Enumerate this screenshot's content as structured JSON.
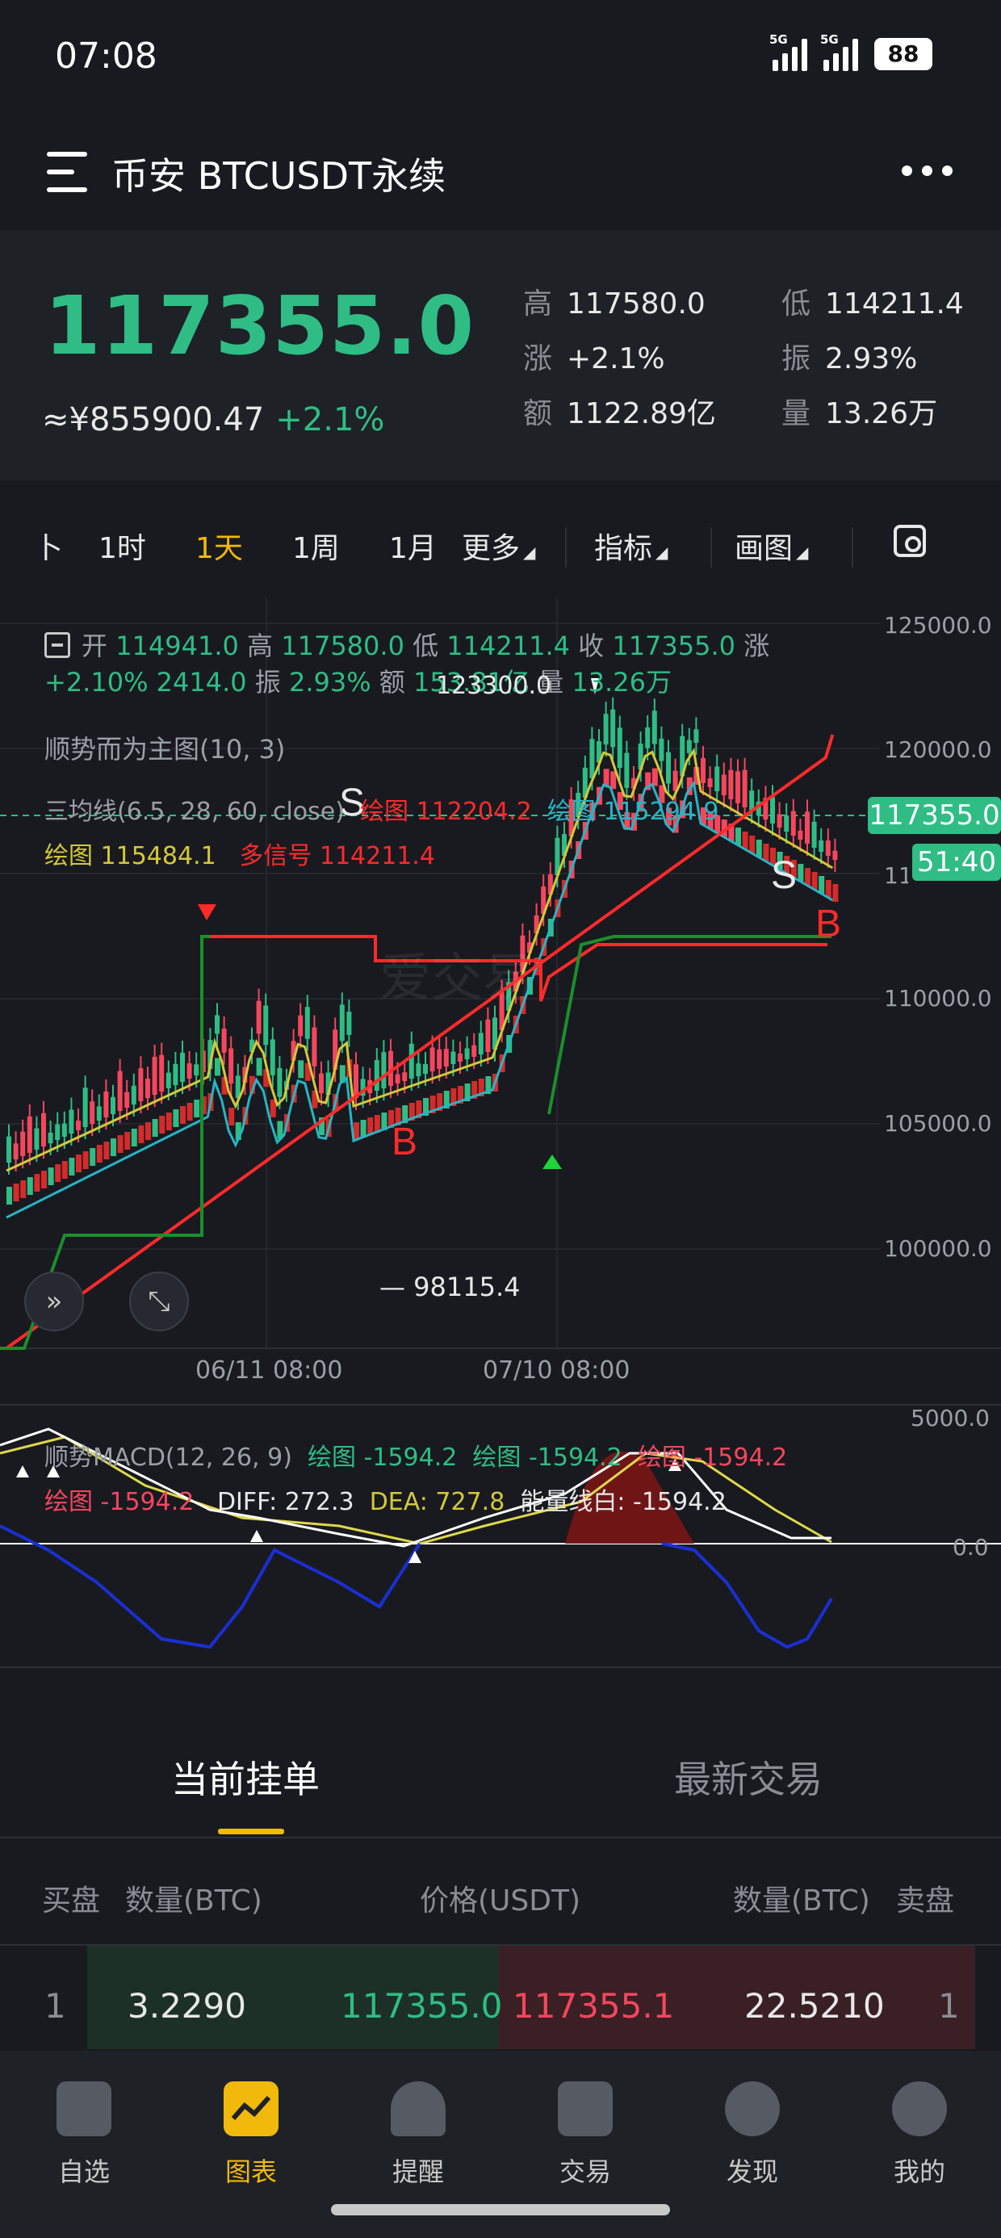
{
  "status_bar": {
    "time": "07:08",
    "network1": "5G",
    "network2": "5G",
    "battery": "88"
  },
  "header": {
    "menu_icon": "menu-icon",
    "title": "币安 BTCUSDT永续",
    "more_icon": "more-dots-icon"
  },
  "ticker": {
    "last_price": "117355.0",
    "cny_value": "≈¥855900.47",
    "change_pct": "+2.1%",
    "stats": {
      "high_label": "高",
      "high": "117580.0",
      "low_label": "低",
      "low": "114211.4",
      "change_label": "涨",
      "change": "+2.1%",
      "amplitude_label": "振",
      "amplitude": "2.93%",
      "amount_label": "额",
      "amount": "1122.89亿",
      "volume_label": "量",
      "volume": "13.26万"
    }
  },
  "timeframe_tabs": {
    "partial": "卜",
    "items": [
      "1时",
      "1天",
      "1周",
      "1月"
    ],
    "active": "1天",
    "more": "更多",
    "indicators": "指标",
    "drawing": "画图"
  },
  "main_chart": {
    "legend": {
      "collapse_icon": "minus-box-icon",
      "open_label": "开",
      "open": "114941.0",
      "high_label": "高",
      "high": "117580.0",
      "low_label": "低",
      "low": "114211.4",
      "close_label": "收",
      "close": "117355.0",
      "change_label": "涨",
      "change_pct": "+2.10%",
      "change_abs": "2414.0",
      "amp_label": "振",
      "amp": "2.93%",
      "amount_label": "额",
      "amount": "153.81亿",
      "vol_label": "量",
      "vol": "13.26万",
      "peak_label": "123300.0"
    },
    "indicator1": "顺势而为主图(10, 3)",
    "indicator2": {
      "name": "三均线(6.5, 28, 60, close)",
      "a_label": "绘图",
      "a": "112204.2",
      "b_label": "绘图",
      "b": "115294.9",
      "c_label": "绘图",
      "c": "115484.1",
      "d_label": "多信号",
      "d": "114211.4"
    },
    "watermark": "爱交易",
    "y_axis": [
      "125000.0",
      "120000.0",
      "115000.0",
      "110000.0",
      "105000.0",
      "100000.0"
    ],
    "x_axis": [
      "06/11 08:00",
      "07/10 08:00"
    ],
    "current_price_tag": "117355.0",
    "countdown_tag": "51:40",
    "low_marker": "— 98115.4",
    "signals": [
      "S",
      "B",
      "S",
      "B"
    ],
    "buttons": {
      "expand_icon": "chevrons-right-icon",
      "fullscreen_icon": "fullscreen-icon"
    }
  },
  "macd": {
    "name": "顺势MACD(12, 26, 9)",
    "a_label": "绘图",
    "a": "-1594.2",
    "b_label": "绘图",
    "b": "-1594.2",
    "c_label": "绘图",
    "c": "-1594.2",
    "d_label": "绘图",
    "d": "-1594.2",
    "diff": "DIFF: 272.3",
    "dea": "DEA: 727.8",
    "energy": "能量线白: -1594.2",
    "y_axis": [
      "5000.0",
      "0.0"
    ]
  },
  "orderbook": {
    "tab_active": "当前挂单",
    "tab_other": "最新交易",
    "headers": {
      "bid": "买盘",
      "bid_qty": "数量(BTC)",
      "price": "价格(USDT)",
      "ask_qty": "数量(BTC)",
      "ask": "卖盘"
    },
    "rows": [
      {
        "bid_idx": "1",
        "bid_qty": "3.2290",
        "bid_price": "117355.0",
        "ask_price": "117355.1",
        "ask_qty": "22.5210",
        "ask_idx": "1"
      }
    ]
  },
  "bottom_nav": {
    "items": [
      {
        "label": "自选",
        "icon": "home-icon"
      },
      {
        "label": "图表",
        "icon": "chart-icon"
      },
      {
        "label": "提醒",
        "icon": "bell-icon"
      },
      {
        "label": "交易",
        "icon": "trade-icon"
      },
      {
        "label": "发现",
        "icon": "discover-icon"
      },
      {
        "label": "我的",
        "icon": "profile-icon"
      }
    ],
    "active": "图表"
  },
  "colors": {
    "up": "#2fbd85",
    "down": "#f6465d",
    "accent": "#f0b90b",
    "bg": "#181a20"
  }
}
